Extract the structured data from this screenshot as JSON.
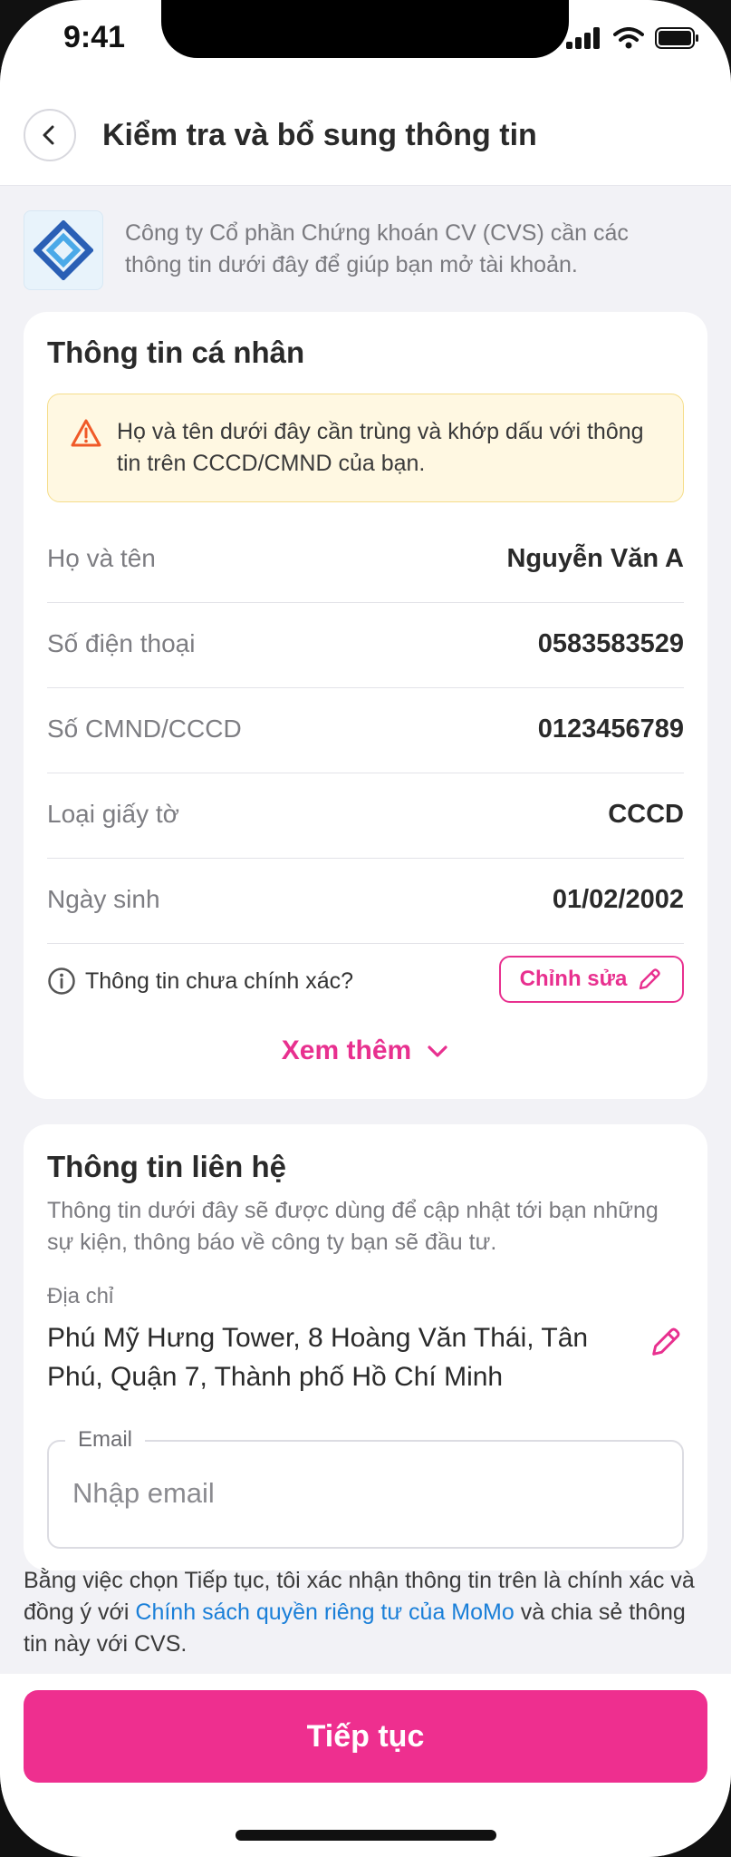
{
  "status": {
    "time": "9:41"
  },
  "header": {
    "title": "Kiểm tra và bổ sung thông tin"
  },
  "intro": {
    "text": "Công ty Cổ phần Chứng khoán CV (CVS) cần các thông tin dưới đây để giúp bạn mở tài khoản."
  },
  "personal": {
    "title": "Thông tin cá nhân",
    "warning": "Họ và tên dưới đây cần trùng và khớp dấu với thông tin trên CCCD/CMND của bạn.",
    "rows": [
      {
        "label": "Họ và tên",
        "value": "Nguyễn Văn A"
      },
      {
        "label": "Số điện thoại",
        "value": "0583583529"
      },
      {
        "label": "Số CMND/CCCD",
        "value": "0123456789"
      },
      {
        "label": "Loại giấy tờ",
        "value": "CCCD"
      },
      {
        "label": "Ngày sinh",
        "value": "01/02/2002"
      }
    ],
    "inaccurate_text": "Thông tin chưa chính xác?",
    "edit_label": "Chỉnh sửa",
    "see_more": "Xem thêm"
  },
  "contact": {
    "title": "Thông tin liên hệ",
    "description": "Thông tin dưới đây sẽ được dùng để cập nhật tới bạn những sự kiện, thông báo về công ty bạn sẽ đầu tư.",
    "address_label": "Địa chỉ",
    "address_value": "Phú Mỹ Hưng Tower, 8 Hoàng Văn Thái, Tân Phú, Quận 7, Thành phố Hồ Chí Minh",
    "email_label": "Email",
    "email_placeholder": "Nhập email",
    "email_value": ""
  },
  "consent": {
    "before": "Bằng việc chọn Tiếp tục, tôi xác nhận thông tin trên là chính xác và đồng ý với ",
    "link": "Chính sách quyền riêng tư của MoMo",
    "after": " và chia sẻ thông tin này với CVS."
  },
  "footer": {
    "continue_label": "Tiếp tục"
  },
  "colors": {
    "accent": "#ee2f8f",
    "link": "#1a7fd8",
    "warning_bg": "#fff8e2",
    "warning_icon": "#f05a28"
  },
  "icons": {
    "back": "chevron-left-icon",
    "logo": "cvs-logo",
    "warning": "warning-triangle-icon",
    "info": "info-circle-icon",
    "edit": "pencil-icon",
    "see_more": "chevron-down-icon"
  }
}
